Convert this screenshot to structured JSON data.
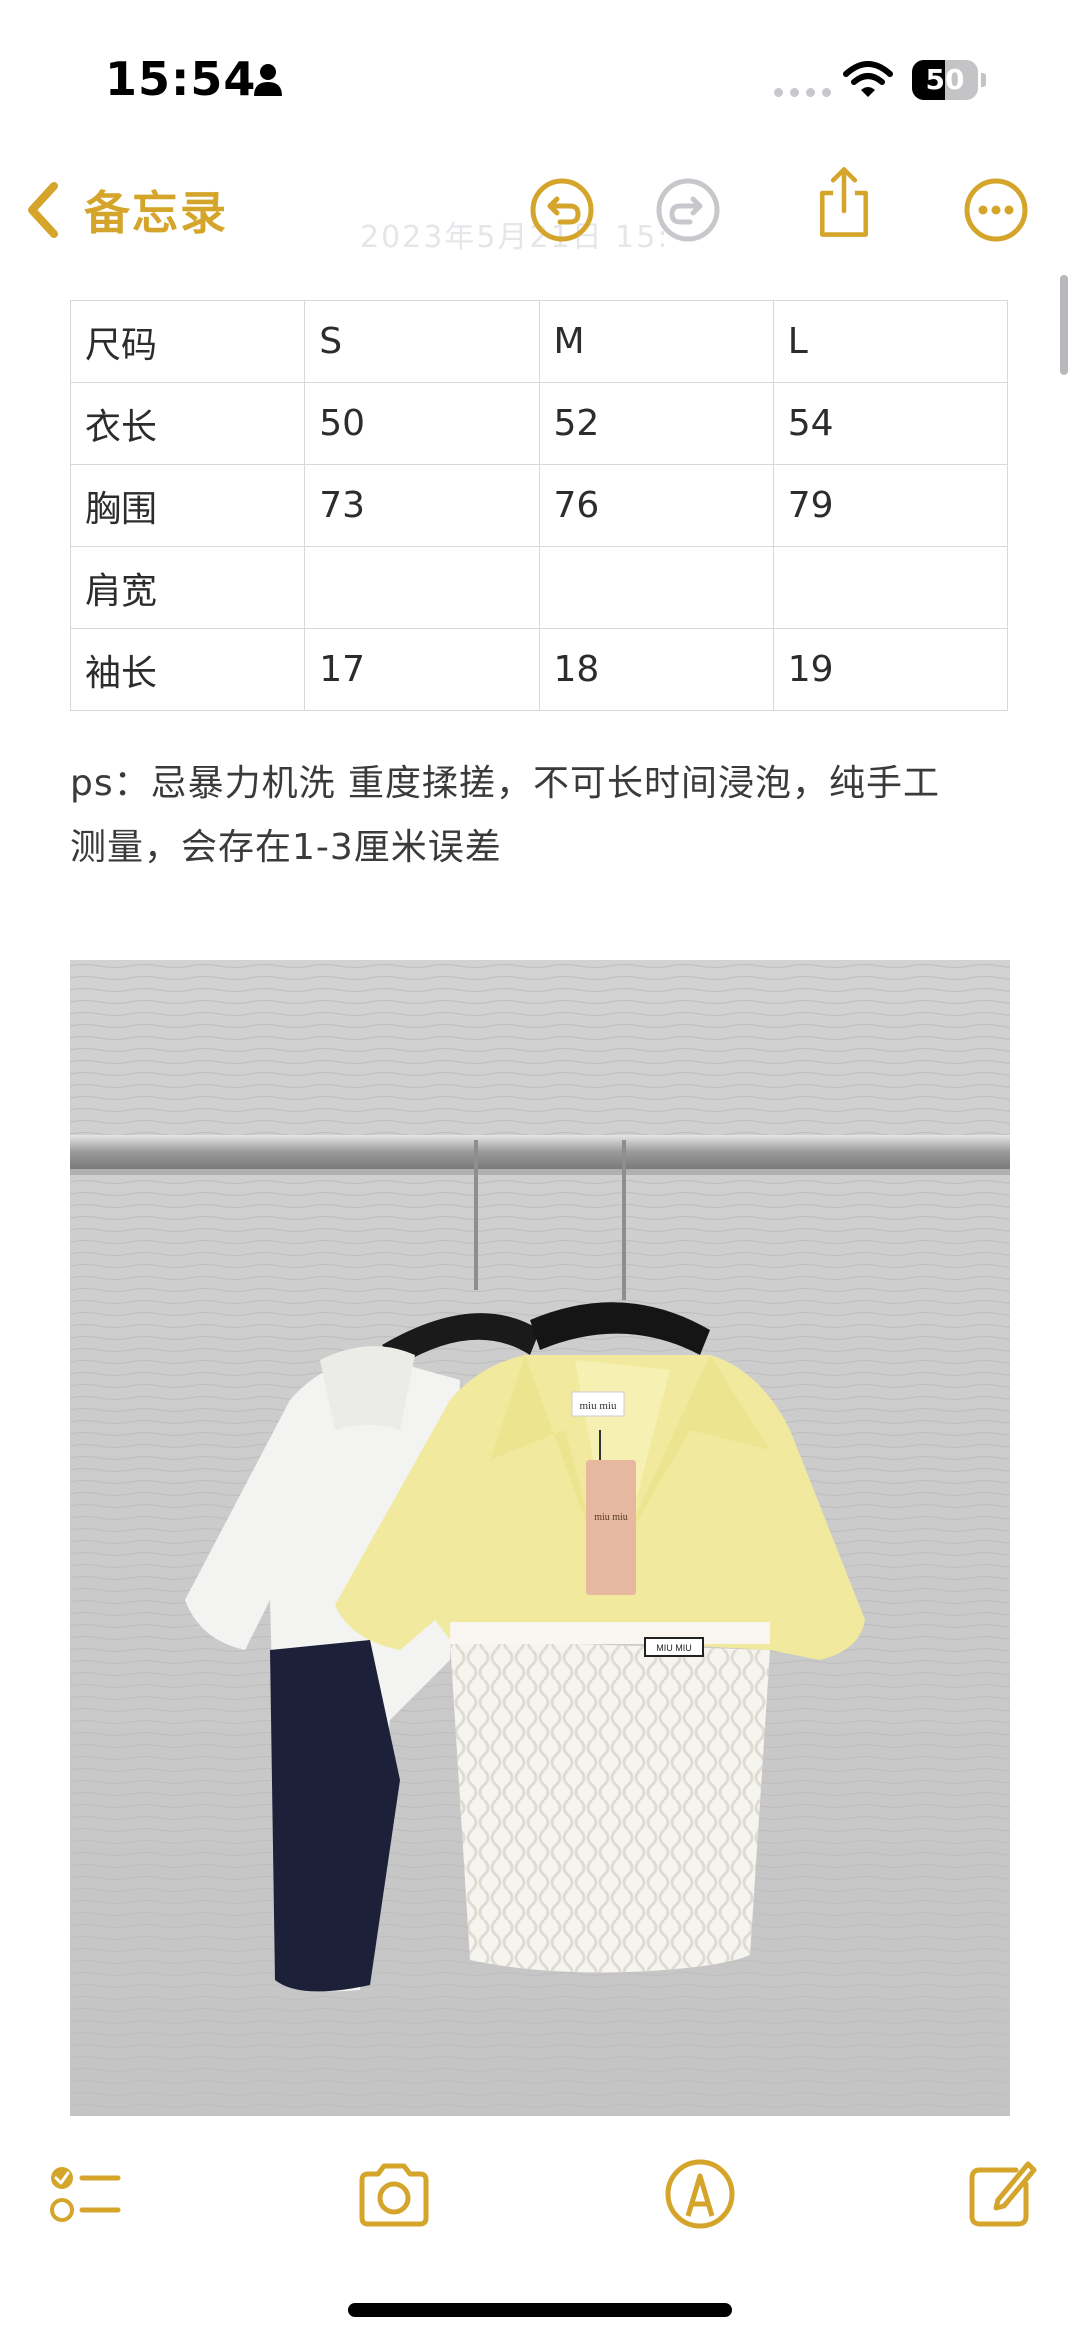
{
  "status_bar": {
    "time": "15:54",
    "battery_level": "50",
    "battery_fraction": 0.5,
    "icons": [
      "person-icon",
      "signal-dots",
      "wifi-icon",
      "battery-icon"
    ]
  },
  "nav": {
    "back_label": "备忘录",
    "date_faded": "2023年5月21日 15:",
    "icons": [
      "undo-icon",
      "redo-icon",
      "share-icon",
      "more-icon"
    ]
  },
  "accent_color": "#d4a52a",
  "table": {
    "rows": [
      [
        "尺码",
        "S",
        "M",
        "L"
      ],
      [
        "衣长",
        "50",
        "52",
        "54"
      ],
      [
        "胸围",
        "73",
        "76",
        "79"
      ],
      [
        "肩宽",
        "",
        "",
        ""
      ],
      [
        "袖长",
        "17",
        "18",
        "19"
      ]
    ]
  },
  "note": {
    "line1": "ps：忌暴力机洗 重度揉搓，不可长时间浸泡，纯手工",
    "line2": "测量，会存在1-3厘米误差"
  },
  "photo": {
    "neck_tag_text": "miu miu",
    "hang_tag_text": "miu miu",
    "chest_label_text": "MIU MIU"
  },
  "toolbar": {
    "icons": [
      "checklist-icon",
      "camera-icon",
      "markup-icon",
      "compose-icon"
    ]
  }
}
